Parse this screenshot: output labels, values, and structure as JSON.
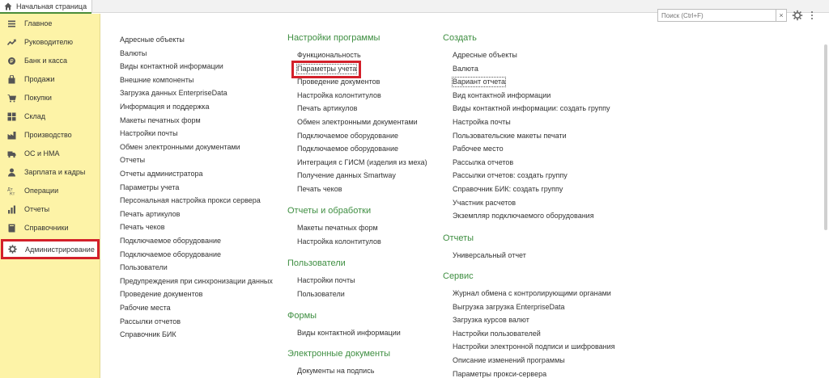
{
  "tab": {
    "label": "Начальная страница"
  },
  "sidebar": {
    "items": [
      {
        "label": "Главное",
        "icon": "menu-icon"
      },
      {
        "label": "Руководителю",
        "icon": "trend-icon"
      },
      {
        "label": "Банк и касса",
        "icon": "coin-icon"
      },
      {
        "label": "Продажи",
        "icon": "bag-icon"
      },
      {
        "label": "Покупки",
        "icon": "cart-icon"
      },
      {
        "label": "Склад",
        "icon": "warehouse-icon"
      },
      {
        "label": "Производство",
        "icon": "factory-icon"
      },
      {
        "label": "ОС и НМА",
        "icon": "truck-icon"
      },
      {
        "label": "Зарплата и кадры",
        "icon": "person-icon"
      },
      {
        "label": "Операции",
        "icon": "operations-icon"
      },
      {
        "label": "Отчеты",
        "icon": "report-icon"
      },
      {
        "label": "Справочники",
        "icon": "book-icon"
      },
      {
        "label": "Администрирование",
        "icon": "gear-icon",
        "active": true
      }
    ]
  },
  "search": {
    "placeholder": "Поиск (Ctrl+F)",
    "clear": "×"
  },
  "col1": {
    "items": [
      "Адресные объекты",
      "Валюты",
      "Виды контактной информации",
      "Внешние компоненты",
      "Загрузка данных EnterpriseData",
      "Информация и поддержка",
      "Макеты печатных форм",
      "Настройки почты",
      "Обмен электронными документами",
      "Отчеты",
      "Отчеты администратора",
      "Параметры учета",
      "Персональная настройка прокси сервера",
      "Печать артикулов",
      "Печать чеков",
      "Подключаемое оборудование",
      "Подключаемое оборудование",
      "Пользователи",
      "Предупреждения при синхронизации данных",
      "Проведение документов",
      "Рабочие места",
      "Рассылки отчетов",
      "Справочник БИК"
    ]
  },
  "col2": {
    "sections": [
      {
        "title": "Настройки программы",
        "items": [
          "Функциональность",
          "Параметры учета",
          "Проведение документов",
          "Настройка колонтитулов",
          "Печать артикулов",
          "Обмен электронными документами",
          "Подключаемое оборудование",
          "Подключаемое оборудование",
          "Интеграция с ГИСМ (изделия из меха)",
          "Получение данных Smartway",
          "Печать чеков"
        ]
      },
      {
        "title": "Отчеты и обработки",
        "items": [
          "Макеты печатных форм",
          "Настройка колонтитулов"
        ]
      },
      {
        "title": "Пользователи",
        "items": [
          "Настройки почты",
          "Пользователи"
        ]
      },
      {
        "title": "Формы",
        "items": [
          "Виды контактной информации"
        ]
      },
      {
        "title": "Электронные документы",
        "items": [
          "Документы на подпись"
        ]
      }
    ]
  },
  "col3": {
    "sections": [
      {
        "title": "Создать",
        "items": [
          "Адресные объекты",
          "Валюта",
          "Вариант отчета",
          "Вид контактной информации",
          "Виды контактной информации: создать группу",
          "Настройка почты",
          "Пользовательские макеты печати",
          "Рабочее место",
          "Рассылка отчетов",
          "Рассылки отчетов: создать группу",
          "Справочник БИК: создать группу",
          "Участник расчетов",
          "Экземпляр подключаемого оборудования"
        ]
      },
      {
        "title": "Отчеты",
        "items": [
          "Универсальный отчет"
        ]
      },
      {
        "title": "Сервис",
        "items": [
          "Журнал обмена с контролирующими органами",
          "Выгрузка загрузка EnterpriseData",
          "Загрузка курсов валют",
          "Настройки пользователей",
          "Настройки электронной подписи и шифрования",
          "Описание изменений программы",
          "Параметры прокси-сервера"
        ]
      }
    ]
  },
  "colors": {
    "accent_green": "#3e8e41",
    "sidebar_bg": "#fdf3a7",
    "highlight_red": "#d3202a"
  }
}
